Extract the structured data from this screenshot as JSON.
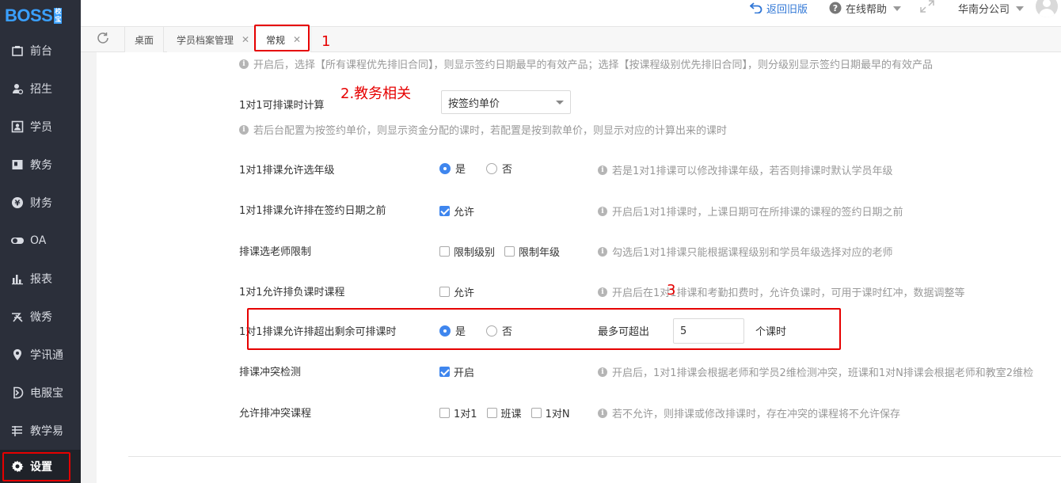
{
  "logo": {
    "text": "BOSS",
    "badge": "校宝"
  },
  "sidebar": {
    "items": [
      {
        "label": "前台",
        "icon": "front-desk-icon"
      },
      {
        "label": "招生",
        "icon": "enroll-icon"
      },
      {
        "label": "学员",
        "icon": "student-icon"
      },
      {
        "label": "教务",
        "icon": "academic-icon"
      },
      {
        "label": "财务",
        "icon": "finance-icon"
      },
      {
        "label": "OA",
        "icon": "oa-toggle-icon"
      },
      {
        "label": "报表",
        "icon": "report-icon"
      },
      {
        "label": "微秀",
        "icon": "weixiu-icon"
      },
      {
        "label": "学讯通",
        "icon": "location-pin-icon"
      },
      {
        "label": "电服宝",
        "icon": "phone-service-icon"
      },
      {
        "label": "教学易",
        "icon": "teaching-icon"
      },
      {
        "label": "设置",
        "icon": "gear-icon"
      }
    ]
  },
  "topbar": {
    "back": "返回旧版",
    "help": "在线帮助",
    "branch": "华南分公司"
  },
  "tabs": [
    {
      "label": "桌面",
      "closable": false
    },
    {
      "label": "学员档案管理",
      "closable": true
    },
    {
      "label": "常规",
      "closable": true,
      "active": true
    }
  ],
  "annotations": {
    "a1": "1",
    "a2": "2.教务相关",
    "a3": "3"
  },
  "settings": {
    "top_hint": "开启后，选择【所有课程优先排旧合同】，则显示签约日期最早的有效产品；选择【按课程级别优先排旧合同】，则分级别显示签约日期最早的有效产品",
    "calc": {
      "label": "1对1可排课时计算",
      "selected": "按签约单价",
      "hint": "若后台配置为按签约单价，则显示资金分配的课时，若配置是按到款单价，则显示对应的计算出来的课时"
    },
    "grade": {
      "label": "1对1排课允许选年级",
      "yes": "是",
      "no": "否",
      "hint": "若是1对1排课可以修改排课年级，若否则排课时默认学员年级"
    },
    "before_sign": {
      "label": "1对1排课允许排在签约日期之前",
      "option": "允许",
      "hint": "开启后1对1排课时，上课日期可在所排课的课程的签约日期之前"
    },
    "teacher_limit": {
      "label": "排课选老师限制",
      "opt1": "限制级别",
      "opt2": "限制年级",
      "hint": "勾选后1对1排课只能根据课程级别和学员年级选择对应的老师"
    },
    "negative": {
      "label": "1对1允许排负课时课程",
      "option": "允许",
      "hint": "开启后在1对1排课和考勤扣费时，允许负课时，可用于课时红冲，数据调整等"
    },
    "exceed": {
      "label": "1对1排课允许排超出剩余可排课时",
      "yes": "是",
      "no": "否",
      "max_label": "最多可超出",
      "value": "5",
      "unit": "个课时"
    },
    "conflict": {
      "label": "排课冲突检测",
      "option": "开启",
      "hint": "开启后，1对1排课会根据老师和学员2维检测冲突，班课和1对N排课会根据老师和教室2维检"
    },
    "allow_conflict": {
      "label": "允许排冲突课程",
      "opt1": "1对1",
      "opt2": "班课",
      "opt3": "1对N",
      "hint": "若不允许，则排课或修改排课时，存在冲突的课程将不允许保存"
    }
  },
  "colors": {
    "accent": "#3f86ee",
    "annotation_red": "#e60000",
    "sidebar_bg": "#2b2f3a",
    "logo_blue": "#3aa0ff"
  }
}
